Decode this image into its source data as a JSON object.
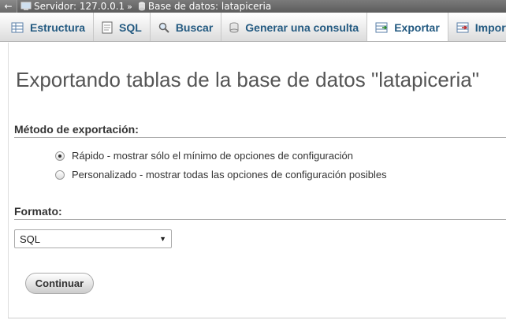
{
  "breadcrumb": {
    "back_icon": "arrow-left-icon",
    "server": "Servidor: 127.0.0.1",
    "separator": "»",
    "database": "Base de datos: latapiceria"
  },
  "tabs": [
    {
      "label": "Estructura",
      "icon": "structure-icon"
    },
    {
      "label": "SQL",
      "icon": "sql-icon"
    },
    {
      "label": "Buscar",
      "icon": "search-icon"
    },
    {
      "label": "Generar una consulta",
      "icon": "query-icon"
    },
    {
      "label": "Exportar",
      "icon": "export-icon",
      "active": true
    },
    {
      "label": "Import",
      "icon": "import-icon"
    }
  ],
  "page": {
    "title": "Exportando tablas de la base de datos \"latapiceria\""
  },
  "export_method": {
    "heading": "Método de exportación:",
    "options": [
      {
        "label": "Rápido - mostrar sólo el mínimo de opciones de configuración",
        "checked": true
      },
      {
        "label": "Personalizado - mostrar todas las opciones de configuración posibles",
        "checked": false
      }
    ]
  },
  "format": {
    "heading": "Formato:",
    "selected": "SQL"
  },
  "actions": {
    "continue_label": "Continuar"
  }
}
